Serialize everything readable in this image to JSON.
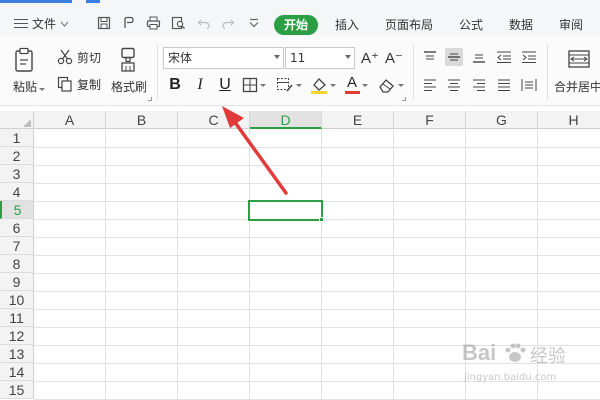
{
  "menubar": {
    "file_label": "文件",
    "tabs": [
      {
        "label": "开始",
        "active": true
      },
      {
        "label": "插入",
        "active": false
      },
      {
        "label": "页面布局",
        "active": false
      },
      {
        "label": "公式",
        "active": false
      },
      {
        "label": "数据",
        "active": false
      },
      {
        "label": "审阅",
        "active": false
      }
    ]
  },
  "ribbon": {
    "paste_label": "粘贴",
    "cut_label": "剪切",
    "copy_label": "复制",
    "format_painter_label": "格式刷",
    "font_name": "宋体",
    "font_size": "11",
    "bold_label": "B",
    "italic_label": "I",
    "underline_label": "U",
    "grow_font_label": "A⁺",
    "shrink_font_label": "A⁻",
    "font_color_label": "A",
    "merge_center_label": "合并居中"
  },
  "grid": {
    "columns": [
      "A",
      "B",
      "C",
      "D",
      "E",
      "F",
      "G",
      "H"
    ],
    "rows": [
      "1",
      "2",
      "3",
      "4",
      "5",
      "6",
      "7",
      "8",
      "9",
      "10",
      "11",
      "12",
      "13",
      "14",
      "15"
    ],
    "selected_column": "D",
    "selected_row": "5"
  },
  "watermark": {
    "brand": "Bai",
    "brand2": "经验",
    "url": "jingyan.baidu.com"
  },
  "colors": {
    "accent_green": "#2c9f45",
    "accent_blue": "#3b7de1",
    "arrow_red": "#e03a3a"
  }
}
